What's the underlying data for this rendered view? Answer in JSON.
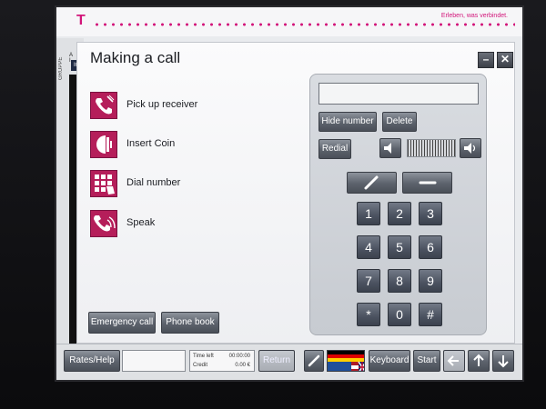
{
  "header": {
    "logo": "T",
    "slogan": "Erleben, was verbindet."
  },
  "side": {
    "vertical_label": "GRUPPE",
    "letters": "G\nA\nI",
    "badge": "IC"
  },
  "dialog": {
    "title": "Making a call",
    "minimize_label": "–",
    "close_label": "✕",
    "steps": [
      {
        "label": "Pick up receiver",
        "icon": "pick-up-receiver-icon"
      },
      {
        "label": "Insert Coin",
        "icon": "insert-coin-icon"
      },
      {
        "label": "Dial number",
        "icon": "dial-number-icon"
      },
      {
        "label": "Speak",
        "icon": "speak-icon"
      }
    ],
    "emergency_label": "Emergency call",
    "phonebook_label": "Phone book"
  },
  "keypad": {
    "number_value": "",
    "hide_number_label": "Hide number",
    "delete_label": "Delete",
    "redial_label": "Redial",
    "keys": [
      "1",
      "2",
      "3",
      "4",
      "5",
      "6",
      "7",
      "8",
      "9",
      "*",
      "0",
      "#"
    ]
  },
  "bottom": {
    "rates_label": "Rates/Help",
    "input_value": "",
    "time_left_label": "Time left",
    "time_left_value": "00:00:00",
    "credit_label": "Credit",
    "credit_value": "0.00 €",
    "return_label": "Return",
    "keyboard_label": "Keyboard",
    "start_label": "Start"
  },
  "colors": {
    "brand_magenta": "#d2157a",
    "step_icon": "#b51e5a",
    "button_gray": "#5c626c"
  }
}
